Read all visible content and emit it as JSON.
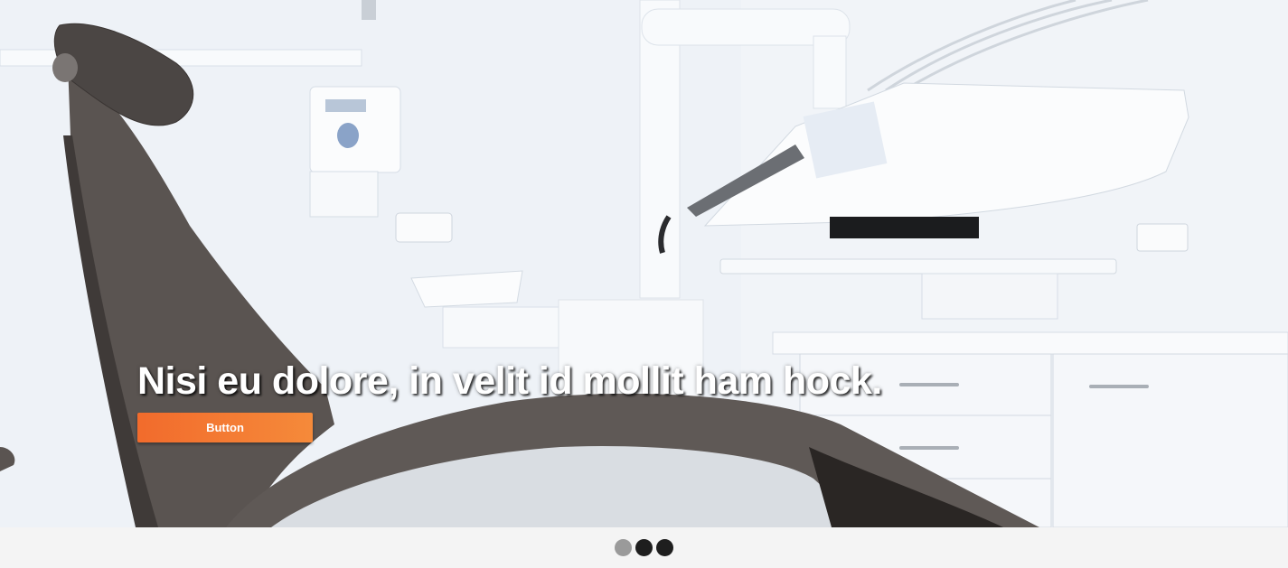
{
  "hero": {
    "headline": "Nisi eu dolore, in velit id mollit ham hock.",
    "button_label": "Button",
    "accent_color": "#f27a33",
    "background_subject": "dental-clinic-chair-photo"
  },
  "carousel": {
    "slide_count": 3,
    "active_index": 0,
    "dots": [
      {
        "state": "active"
      },
      {
        "state": "inactive"
      },
      {
        "state": "inactive"
      }
    ]
  }
}
